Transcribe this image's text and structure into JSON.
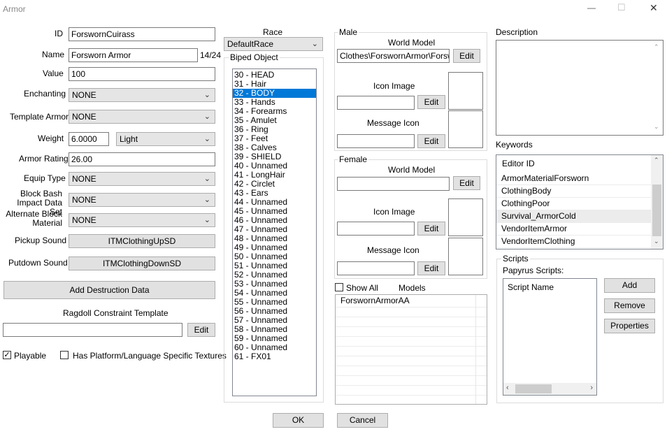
{
  "window": {
    "title": "Armor",
    "minimize_glyph": "—",
    "maximize_glyph": "☐",
    "close_glyph": "✕"
  },
  "form": {
    "id_label": "ID",
    "id_value": "ForswornCuirass",
    "name_label": "Name",
    "name_value": "Forsworn Armor",
    "name_count": "14/24",
    "value_label": "Value",
    "value_value": "100",
    "enchanting_label": "Enchanting",
    "enchanting_value": "NONE",
    "template_label": "Template Armor",
    "template_value": "NONE",
    "weight_label": "Weight",
    "weight_value": "6.0000",
    "weight_class": "Light",
    "armor_rating_label": "Armor Rating",
    "armor_rating_value": "26.00",
    "equip_type_label": "Equip Type",
    "equip_type_value": "NONE",
    "block_bash_label": "Block Bash Impact Data Set",
    "block_bash_value": "NONE",
    "alt_block_label": "Alternate Block Material",
    "alt_block_value": "NONE",
    "pickup_label": "Pickup Sound",
    "pickup_value": "ITMClothingUpSD",
    "putdown_label": "Putdown Sound",
    "putdown_value": "ITMClothingDownSD",
    "add_destruction": "Add Destruction Data",
    "ragdoll_label": "Ragdoll Constraint Template",
    "ragdoll_value": "",
    "ragdoll_edit": "Edit",
    "playable_label": "Playable",
    "playable_checked": true,
    "platform_label": "Has Platform/Language Specific Textures",
    "platform_checked": false
  },
  "race": {
    "label": "Race",
    "value": "DefaultRace"
  },
  "biped": {
    "title": "Biped Object",
    "selected_index": 2,
    "items": [
      "30 - HEAD",
      "31 - Hair",
      "32 - BODY",
      "33 - Hands",
      "34 - Forearms",
      "35 - Amulet",
      "36 - Ring",
      "37 - Feet",
      "38 - Calves",
      "39 - SHIELD",
      "40 - Unnamed",
      "41 - LongHair",
      "42 - Circlet",
      "43 - Ears",
      "44 - Unnamed",
      "45 - Unnamed",
      "46 - Unnamed",
      "47 - Unnamed",
      "48 - Unnamed",
      "49 - Unnamed",
      "50 - Unnamed",
      "51 - Unnamed",
      "52 - Unnamed",
      "53 - Unnamed",
      "54 - Unnamed",
      "55 - Unnamed",
      "56 - Unnamed",
      "57 - Unnamed",
      "58 - Unnamed",
      "59 - Unnamed",
      "60 - Unnamed",
      "61 - FX01"
    ]
  },
  "male": {
    "title": "Male",
    "world_model_label": "World Model",
    "world_model_value": "Clothes\\ForswornArmor\\ForswornCuirass",
    "icon_label": "Icon Image",
    "icon_value": "",
    "message_icon_label": "Message Icon",
    "message_icon_value": "",
    "edit": "Edit"
  },
  "female": {
    "title": "Female",
    "world_model_label": "World Model",
    "world_model_value": "",
    "icon_label": "Icon Image",
    "icon_value": "",
    "message_icon_label": "Message Icon",
    "message_icon_value": "",
    "edit": "Edit"
  },
  "models": {
    "show_all_label": "Show All",
    "models_label": "Models",
    "items": [
      "ForswornArmorAA"
    ]
  },
  "description": {
    "label": "Description",
    "value": ""
  },
  "keywords": {
    "label": "Keywords",
    "header": "Editor ID",
    "items": [
      "ArmorMaterialForsworn",
      "ClothingBody",
      "ClothingPoor",
      "Survival_ArmorCold",
      "VendorItemArmor",
      "VendorItemClothing"
    ],
    "highlighted_index": 3
  },
  "scripts": {
    "title": "Scripts",
    "papyrus_label": "Papyrus Scripts:",
    "header": "Script Name",
    "add": "Add",
    "remove": "Remove",
    "properties": "Properties"
  },
  "footer": {
    "ok": "OK",
    "cancel": "Cancel"
  }
}
